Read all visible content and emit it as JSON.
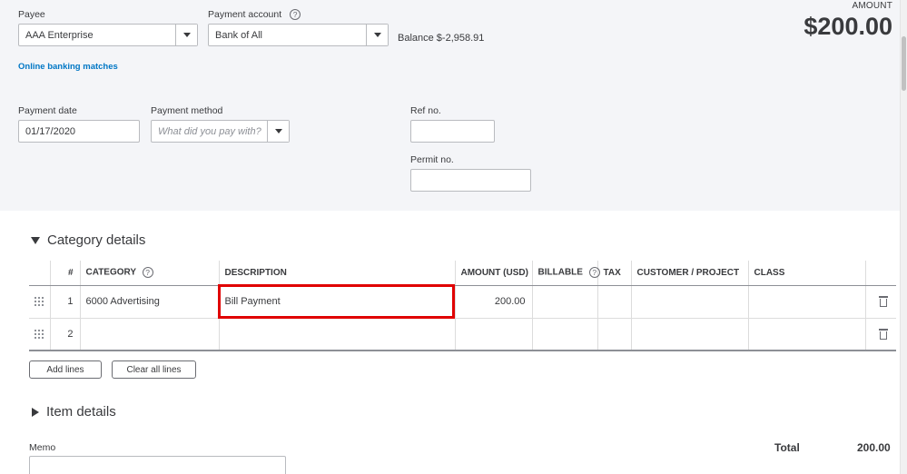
{
  "header": {
    "payee": {
      "label": "Payee",
      "value": "AAA Enterprise"
    },
    "payment_account": {
      "label": "Payment account",
      "help": "?",
      "value": "Bank of All"
    },
    "balance": "Balance $-2,958.91",
    "online_banking_link": "Online banking matches",
    "amount": {
      "label": "AMOUNT",
      "value": "$200.00"
    },
    "payment_date": {
      "label": "Payment date",
      "value": "01/17/2020"
    },
    "payment_method": {
      "label": "Payment method",
      "placeholder": "What did you pay with?"
    },
    "ref_no": {
      "label": "Ref no.",
      "value": ""
    },
    "permit_no": {
      "label": "Permit no.",
      "value": ""
    }
  },
  "category_details": {
    "title": "Category details",
    "columns": [
      "#",
      "CATEGORY",
      "DESCRIPTION",
      "AMOUNT (USD)",
      "BILLABLE",
      "TAX",
      "CUSTOMER / PROJECT",
      "CLASS"
    ],
    "category_help": "?",
    "billable_help": "?",
    "rows": [
      {
        "num": "1",
        "category": "6000 Advertising",
        "description": "Bill Payment",
        "amount": "200.00",
        "billable": "",
        "tax": "",
        "customer": "",
        "class": ""
      },
      {
        "num": "2",
        "category": "",
        "description": "",
        "amount": "",
        "billable": "",
        "tax": "",
        "customer": "",
        "class": ""
      }
    ],
    "add_lines": "Add lines",
    "clear_all_lines": "Clear all lines"
  },
  "item_details": {
    "title": "Item details"
  },
  "memo": {
    "label": "Memo",
    "value": ""
  },
  "total": {
    "label": "Total",
    "value": "200.00"
  },
  "colors": {
    "accent_link": "#0077c5",
    "highlight": "#e00000",
    "header_bg": "#f4f5f8"
  }
}
